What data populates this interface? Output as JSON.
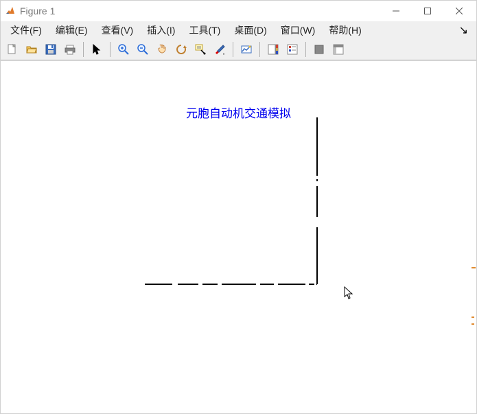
{
  "window": {
    "title": "Figure 1"
  },
  "menu": {
    "items": [
      "文件(F)",
      "编辑(E)",
      "查看(V)",
      "插入(I)",
      "工具(T)",
      "桌面(D)",
      "窗口(W)",
      "帮助(H)"
    ],
    "right_glyph": "↘"
  },
  "toolbar": {
    "icons": [
      "new-file-icon",
      "open-file-icon",
      "save-icon",
      "print-icon",
      "sep",
      "pointer-icon",
      "sep",
      "zoom-in-icon",
      "zoom-out-icon",
      "pan-icon",
      "rotate-icon",
      "data-cursor-icon",
      "brush-icon",
      "sep",
      "link-axes-icon",
      "sep",
      "colorbar-icon",
      "legend-icon",
      "sep",
      "hide-plot-tools-icon",
      "show-plot-tools-icon"
    ]
  },
  "plot": {
    "title": "元胞自动机交通模拟"
  }
}
